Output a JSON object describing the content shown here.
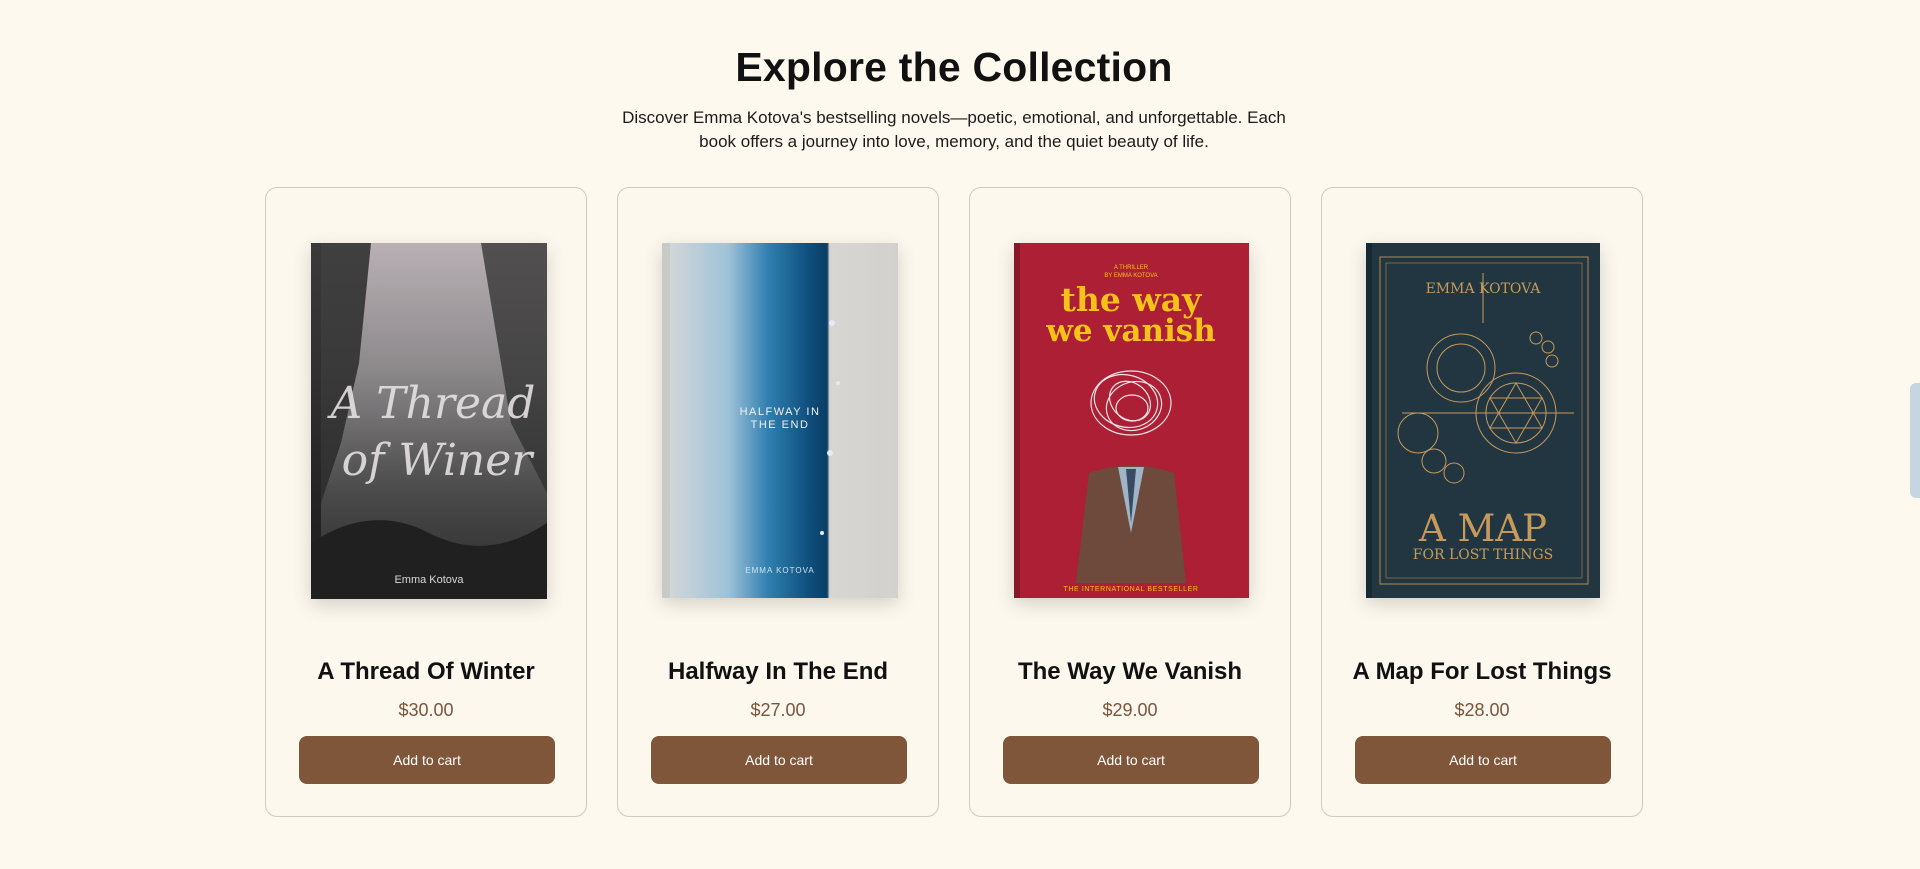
{
  "section": {
    "title": "Explore the Collection",
    "subtitle": "Discover Emma Kotova's bestselling novels—poetic, emotional, and unforgettable. Each book offers a journey into love, memory, and the quiet beauty of life."
  },
  "colors": {
    "background": "#fdf9ef",
    "button": "#80563b",
    "price": "#7a553b"
  },
  "products": [
    {
      "title": "A Thread Of Winter",
      "price": "$30.00",
      "button_label": "Add to cart",
      "cover": {
        "line1": "A Thread",
        "line2": "of Winer",
        "author": "Emma Kotova"
      }
    },
    {
      "title": "Halfway In The End",
      "price": "$27.00",
      "button_label": "Add to cart",
      "cover": {
        "line1": "HALFWAY IN",
        "line2": "THE END",
        "author": "EMMA KOTOVA"
      }
    },
    {
      "title": "The Way We Vanish",
      "price": "$29.00",
      "button_label": "Add to cart",
      "cover": {
        "kicker1": "A THRILLER",
        "kicker2": "BY EMMA KOTOVA",
        "line1": "the way",
        "line2": "we vanish",
        "footer": "THE INTERNATIONAL BESTSELLER"
      }
    },
    {
      "title": "A Map For Lost Things",
      "price": "$28.00",
      "button_label": "Add to cart",
      "cover": {
        "author": "EMMA KOTOVA",
        "line1": "A MAP",
        "line2": "FOR LOST THINGS"
      }
    }
  ]
}
